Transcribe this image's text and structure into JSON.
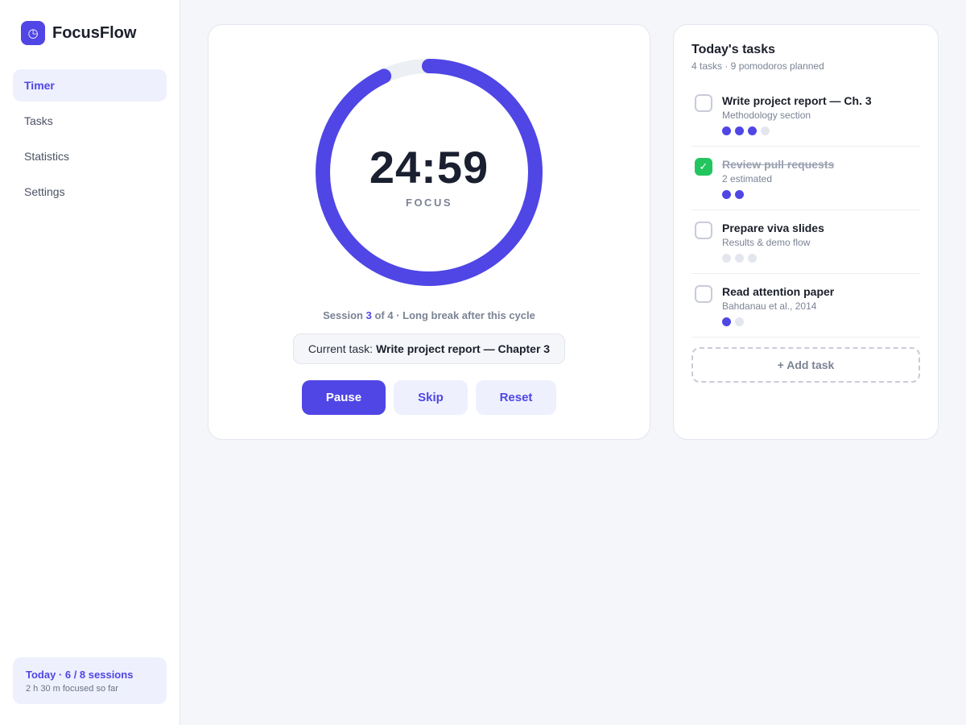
{
  "brand": {
    "name": "FocusFlow",
    "logo_icon": "◷"
  },
  "nav": {
    "items": [
      "Timer",
      "Tasks",
      "Statistics",
      "Settings"
    ],
    "active": "Timer"
  },
  "today": {
    "title": "Today · 6 / 8 sessions",
    "subtitle": "2 h 30 m focused so far"
  },
  "timer": {
    "time": "24:59",
    "mode": "FOCUS",
    "progress": 0.93,
    "session_prefix": "Session",
    "session_current": "3",
    "session_suffix": "of 4 · Long break after this cycle",
    "current_task_label": "Current task:",
    "current_task_name": "Write project report — Chapter 3"
  },
  "controls": {
    "pause": "Pause",
    "skip": "Skip",
    "reset": "Reset"
  },
  "tasks_panel": {
    "title": "Today's tasks",
    "subtitle": "4 tasks · 9 pomodoros planned",
    "add_label": "+ Add task",
    "items": [
      {
        "name": "Write project report — Ch. 3",
        "note": "Methodology section",
        "done": false,
        "completed_pomodoros": 3,
        "total_pomodoros": 4
      },
      {
        "name": "Review pull requests",
        "note": "2 estimated",
        "done": true,
        "completed_pomodoros": 2,
        "total_pomodoros": 2
      },
      {
        "name": "Prepare viva slides",
        "note": "Results & demo flow",
        "done": false,
        "completed_pomodoros": 0,
        "total_pomodoros": 3
      },
      {
        "name": "Read attention paper",
        "note": "Bahdanau et al., 2014",
        "done": false,
        "completed_pomodoros": 1,
        "total_pomodoros": 2
      }
    ]
  },
  "colors": {
    "accent": "#4f46e5",
    "done": "#22c55e",
    "track": "#eceff4"
  },
  "checkmark": "✓"
}
